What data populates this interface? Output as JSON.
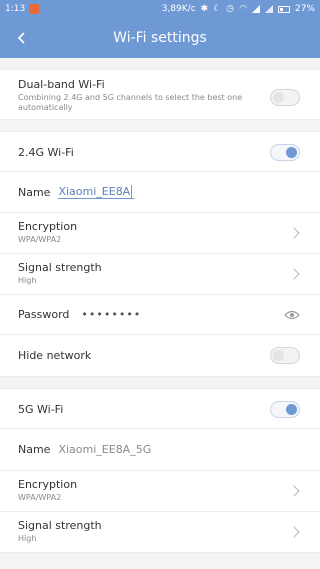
{
  "status_bar": {
    "time": "1:13",
    "speed": "3,89K/c",
    "battery": "27%"
  },
  "app_bar": {
    "title": "Wi-Fi settings"
  },
  "dual_band": {
    "label": "Dual-band Wi-Fi",
    "description": "Combining 2.4G and 5G channels to select the best one automatically",
    "enabled": false
  },
  "band_24": {
    "label": "2.4G Wi-Fi",
    "enabled": true,
    "name_label": "Name",
    "name_value": "Xiaomi_EE8A",
    "encryption_label": "Encryption",
    "encryption_value": "WPA/WPA2",
    "signal_label": "Signal strength",
    "signal_value": "High",
    "password_label": "Password",
    "password_value": "••••••••",
    "hide_label": "Hide network",
    "hide_enabled": false
  },
  "band_5": {
    "label": "5G Wi-Fi",
    "enabled": true,
    "name_label": "Name",
    "name_value": "Xiaomi_EE8A_5G",
    "encryption_label": "Encryption",
    "encryption_value": "WPA/WPA2",
    "signal_label": "Signal strength",
    "signal_value": "High"
  },
  "icons": {
    "back": "back-arrow-icon",
    "chevron": "chevron-right-icon",
    "eye": "eye-icon"
  },
  "colors": {
    "accent": "#6f99d4",
    "background": "#f4f4f4"
  }
}
